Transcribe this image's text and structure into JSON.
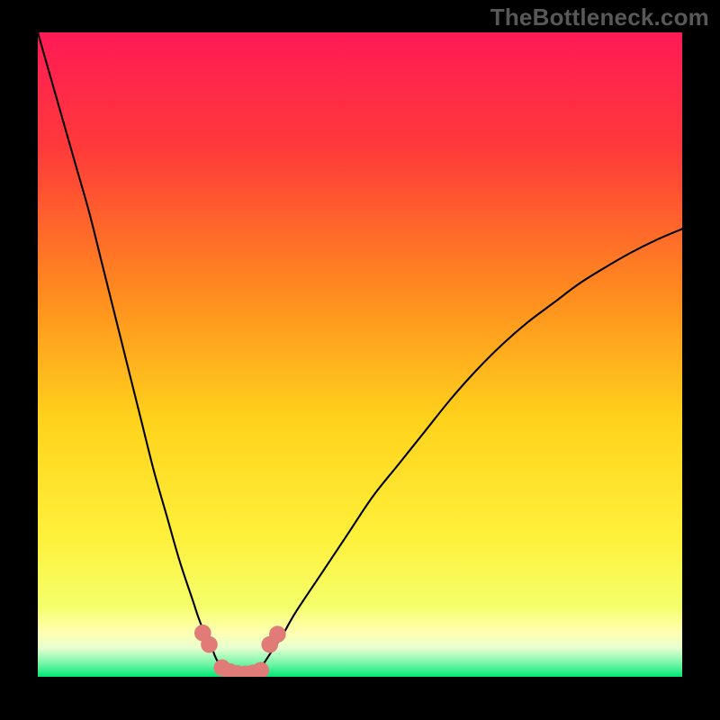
{
  "watermark": "TheBottleneck.com",
  "chart_data": {
    "type": "line",
    "title": "",
    "xlabel": "",
    "ylabel": "",
    "xlim": [
      0,
      100
    ],
    "ylim": [
      0,
      100
    ],
    "grid": false,
    "background_gradient": {
      "stops": [
        {
          "offset": 0.0,
          "color": "#ff1a56"
        },
        {
          "offset": 0.18,
          "color": "#ff3a3a"
        },
        {
          "offset": 0.4,
          "color": "#ff8a1f"
        },
        {
          "offset": 0.6,
          "color": "#ffd21c"
        },
        {
          "offset": 0.78,
          "color": "#fff03a"
        },
        {
          "offset": 0.89,
          "color": "#f4ff6a"
        },
        {
          "offset": 0.93,
          "color": "#ffffb0"
        },
        {
          "offset": 0.955,
          "color": "#e8ffd0"
        },
        {
          "offset": 0.98,
          "color": "#72f5a8"
        },
        {
          "offset": 1.0,
          "color": "#00e874"
        }
      ]
    },
    "series": [
      {
        "name": "left-branch",
        "color": "#000000",
        "x": [
          0,
          2,
          4,
          6,
          8,
          10,
          12,
          14,
          16,
          18,
          20,
          22,
          24,
          25,
          26,
          27,
          27.5,
          28,
          28.5,
          29,
          29.7
        ],
        "y": [
          100,
          93,
          86,
          79,
          72,
          64,
          56,
          48,
          40,
          32,
          25,
          18,
          12,
          9,
          6.5,
          4.5,
          3.2,
          2.2,
          1.4,
          0.7,
          0.2
        ]
      },
      {
        "name": "right-branch",
        "color": "#000000",
        "x": [
          33.3,
          34,
          35,
          36,
          38,
          40,
          44,
          48,
          52,
          56,
          60,
          64,
          68,
          72,
          76,
          80,
          84,
          88,
          92,
          96,
          100
        ],
        "y": [
          0.2,
          0.8,
          2.0,
          3.5,
          6.5,
          10,
          16,
          22,
          28,
          33,
          38,
          43,
          47.5,
          51.5,
          55,
          58,
          61,
          63.5,
          65.8,
          67.8,
          69.5
        ]
      },
      {
        "name": "floor",
        "color": "#000000",
        "x": [
          29.7,
          30.5,
          31.5,
          32.5,
          33.3
        ],
        "y": [
          0.2,
          0.05,
          0.0,
          0.05,
          0.2
        ]
      }
    ],
    "markers": [
      {
        "name": "left-upper-a",
        "x": 25.6,
        "y": 6.8,
        "r": 1.3,
        "color": "#e07b78"
      },
      {
        "name": "left-upper-b",
        "x": 26.6,
        "y": 5.0,
        "r": 1.3,
        "color": "#e07b78"
      },
      {
        "name": "right-upper-a",
        "x": 36.0,
        "y": 5.0,
        "r": 1.3,
        "color": "#e07b78"
      },
      {
        "name": "right-upper-b",
        "x": 37.2,
        "y": 6.6,
        "r": 1.3,
        "color": "#e07b78"
      },
      {
        "name": "floor-1",
        "x": 28.6,
        "y": 1.4,
        "r": 1.3,
        "color": "#e07b78"
      },
      {
        "name": "floor-2",
        "x": 29.8,
        "y": 0.8,
        "r": 1.3,
        "color": "#e07b78"
      },
      {
        "name": "floor-3",
        "x": 31.0,
        "y": 0.5,
        "r": 1.3,
        "color": "#e07b78"
      },
      {
        "name": "floor-4",
        "x": 32.2,
        "y": 0.45,
        "r": 1.3,
        "color": "#e07b78"
      },
      {
        "name": "floor-5",
        "x": 33.4,
        "y": 0.6,
        "r": 1.3,
        "color": "#e07b78"
      },
      {
        "name": "floor-6",
        "x": 34.6,
        "y": 1.0,
        "r": 1.3,
        "color": "#e07b78"
      }
    ]
  }
}
